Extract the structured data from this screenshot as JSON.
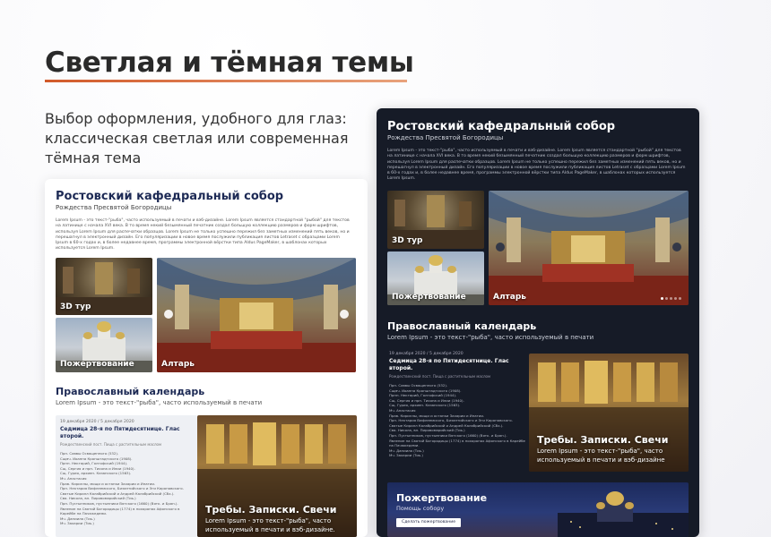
{
  "page": {
    "headline": "Светлая и тёмная темы",
    "subtitle": "Выбор оформления, удобного для глаз: классическая светлая или современная тёмная тема"
  },
  "colors": {
    "accent": "#d25a2a",
    "brand_navy": "#1d2a55",
    "dark_bg": "#161b27"
  },
  "light": {
    "title": "Ростовский кафедральный собор",
    "subtitle": "Рождества Пресвятой Богородицы",
    "body": "Lorem Ipsum - это текст-\"рыба\", часто используемый в печати и вэб-дизайне. Lorem Ipsum является стандартной \"рыбой\" для текстов на латинице с начала XVI века. В то время некий безымянный печатник создал большую коллекцию размеров и форм шрифтов, используя Lorem Ipsum для распечатки образцов. Lorem Ipsum не только успешно пережил без заметных изменений пять веков, но и перешагнул в электронный дизайн. Его популяризации в новое время послужили публикация листов Letraset с образцами Lorem Ipsum в 60-х годах и, в более недавнее время, программы электронной вёрстки типа Aldus PageMaker, в шаблонах которых используется Lorem Ipsum.",
    "tiles": {
      "tour": "3D тур",
      "donation": "Пожертвование",
      "altar": "Алтарь"
    },
    "calendar": {
      "title": "Православный календарь",
      "subtitle": "Lorem Ipsum - это текст-\"рыба\", часто используемый в печати",
      "date": "19 декабря 2020 / 5 декабря 2020",
      "heading": "Седмица 28-я по Пятидесятнице. Глас второй.",
      "note": "Рождественский пост. Пища с растительным маслом",
      "saints": [
        "Прп. Саввы Освященного (532).",
        "Сщмч. Иоанна Кронштадтского (1908).",
        "Прпп. Нектарий, Голгофский (1944).",
        "Сщ. Сергия и прп. Тихона и Илии (1940).",
        "Сщ. Гурия, архиеп. Казанского (1563).",
        "Мч. Анастасия",
        "Прав. Кириллы, мощи и останки Захарии и Ипатии.",
        "Прп. Нектария Вифлеемского, Бизантийского и Эги Кароповского.",
        "Святые Кирилл Калабрийский и Андрей Калабрийский (Сбх.).",
        "Свя. Никола, вл. Пировомарийский (Тиь.)",
        "Прп. Пустынников, пустынники Вятского (1660) (Вятк. и Брян.).",
        "Явление на Святой Богородицы (1774) в похоронах Афонского в Карейбе на Пачюкедеми.",
        "Мч. Даниила (Тиь.)",
        "Мч. Захарии (Тиь.)"
      ]
    },
    "feature": {
      "title": "Требы. Записки. Свечи",
      "text": "Lorem Ipsum - это текст-\"рыба\", часто используемый в печати и вэб-дизайне."
    }
  },
  "dark": {
    "title": "Ростовский кафедральный собор",
    "subtitle": "Рождества Пресвятой Богородицы",
    "body": "Lorem Ipsum - это текст-\"рыба\", часто используемый в печати и вэб-дизайне. Lorem Ipsum является стандартной \"рыбой\" для текстов на латинице с начала XVI века. В то время некий безымянный печатник создал большую коллекцию размеров и форм шрифтов, используя Lorem Ipsum для распечатки образцов. Lorem Ipsum не только успешно пережил без заметных изменений пять веков, но и перешагнул в электронный дизайн. Его популяризации в новое время послужили публикация листов Letraset с образцами Lorem Ipsum в 60-х годах и, в более недавнее время, программы электронной вёрстки типа Aldus PageMaker, в шаблонах которых используется Lorem Ipsum.",
    "tiles": {
      "tour": "3D тур",
      "donation": "Пожертвование",
      "altar": "Алтарь"
    },
    "calendar": {
      "title": "Православный календарь",
      "subtitle": "Lorem Ipsum - это текст-\"рыба\", часто используемый в печати",
      "date": "19 декабря 2020 / 5 декабря 2020",
      "heading": "Седмица 28-я по Пятидесятнице. Глас второй.",
      "note": "Рождественский пост. Пища с растительным маслом",
      "saints": [
        "Прп. Саввы Освященного (532).",
        "Сщмч. Иоанна Кронштадтского (1908).",
        "Прпп. Нектарий, Голгофский (1944).",
        "Сщ. Сергия и прп. Тихона и Илии (1940).",
        "Сщ. Гурия, архиеп. Казанского (1563).",
        "Мч. Анастасия",
        "Прав. Кириллы, мощи и останки Захарии и Ипатии.",
        "Прп. Нектария Вифлеемского, Бизантийского и Эги Кароповского.",
        "Святые Кирилл Калабрийский и Андрей Калабрийский (Сбх.).",
        "Свя. Никола, вл. Пировомарийский (Тиь.)",
        "Прп. Пустынников, пустынники Вятского (1660) (Вятк. и Брян.).",
        "Явление на Святой Богородицы (1774) в похоронах Афонского в Карейбе на Пачюкедеми.",
        "Мч. Даниила (Тиь.)",
        "Мч. Захарии (Тиь.)"
      ]
    },
    "feature": {
      "title": "Требы. Записки. Свечи",
      "text": "Lorem Ipsum - это текст-\"рыба\", часто используемый в печати и вэб-дизайне"
    },
    "donation": {
      "title": "Пожертвование",
      "subtitle": "Помощь собору",
      "button": "Сделать пожертвование"
    }
  }
}
